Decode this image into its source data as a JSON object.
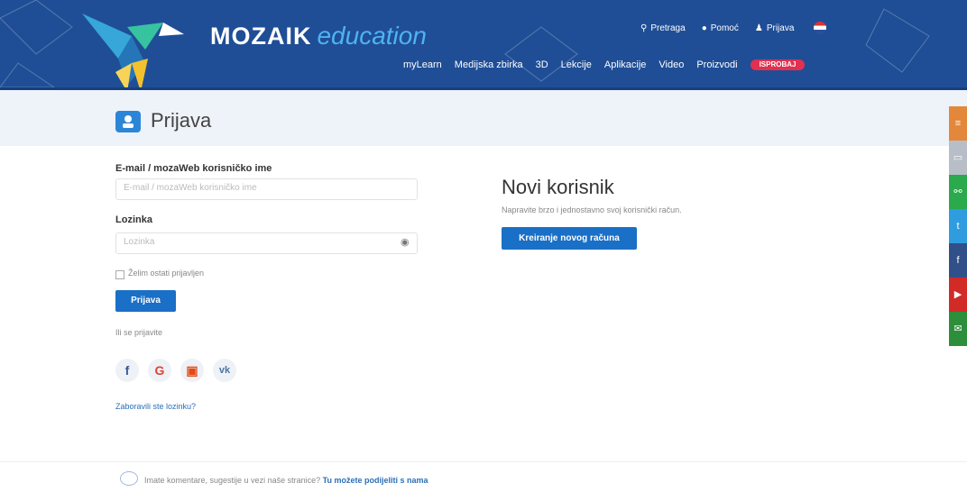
{
  "brand": {
    "name": "MOZAIK",
    "sub": "education"
  },
  "toplinks": {
    "search": "Pretraga",
    "help": "Pomoć",
    "login": "Prijava"
  },
  "nav": [
    "myLearn",
    "Medijska zbirka",
    "3D",
    "Lekcije",
    "Aplikacije",
    "Video",
    "Proizvodi"
  ],
  "nav_try": "ISPROBAJ",
  "page_title": "Prijava",
  "form": {
    "email_label": "E-mail / mozaWeb korisničko ime",
    "email_placeholder": "E-mail / mozaWeb korisničko ime",
    "password_label": "Lozinka",
    "password_placeholder": "Lozinka",
    "remember": "Želim ostati prijavljen",
    "submit": "Prijava",
    "or_login": "Ili se prijavite",
    "forgot": "Zaboravili ste lozinku?"
  },
  "new_user": {
    "heading": "Novi korisnik",
    "desc": "Napravite brzo i jednostavno svoj korisnički račun.",
    "create": "Kreiranje novog računa"
  },
  "footer": {
    "text": "Imate komentare, sugestije u vezi naše stranice?",
    "link": "Tu možete podijeliti s nama"
  },
  "colors": {
    "header": "#1f4e96",
    "accent": "#1a6fc6",
    "try": "#e2304f"
  },
  "social": [
    "facebook-icon",
    "google-icon",
    "office-icon",
    "vk-icon"
  ],
  "sidebar": [
    "list-icon",
    "comment-icon",
    "share-icon",
    "twitter-icon",
    "facebook-icon",
    "youtube-icon",
    "mail-icon"
  ]
}
